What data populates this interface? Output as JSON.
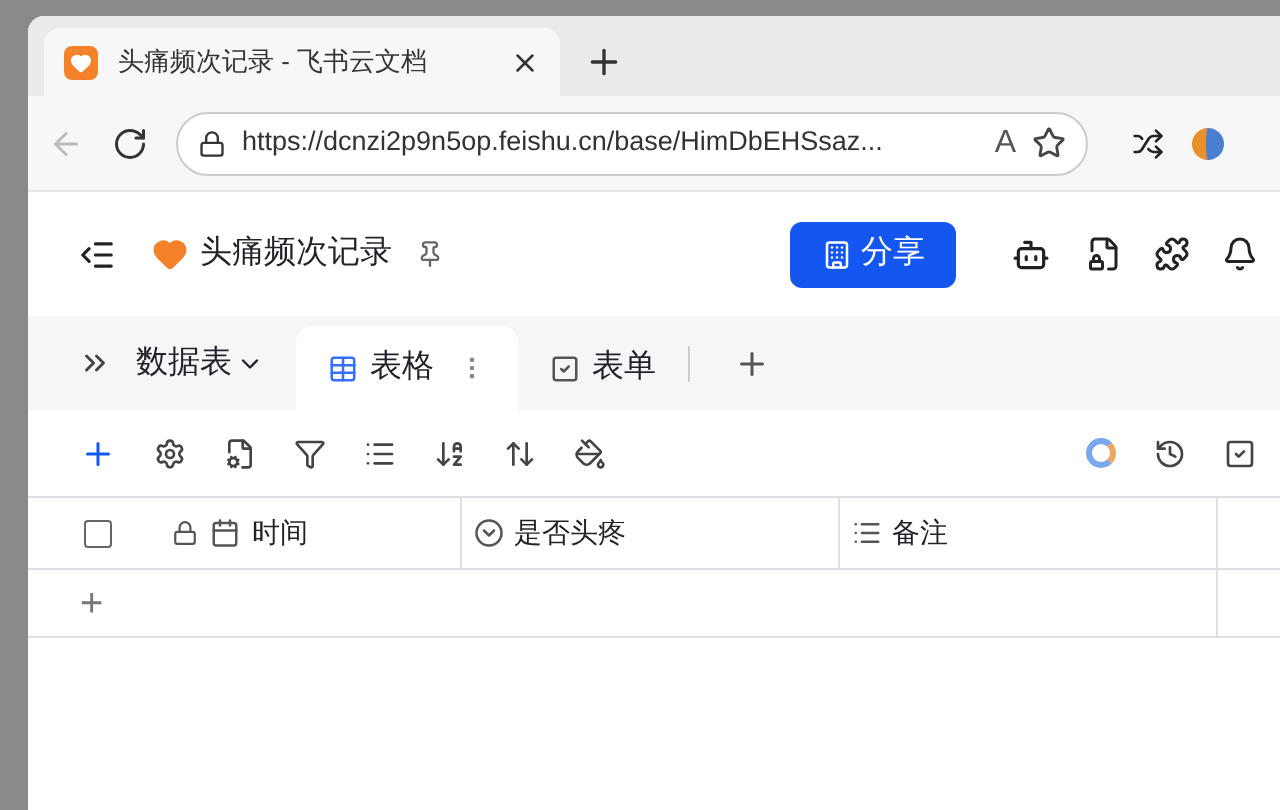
{
  "browser": {
    "tab_title": "头痛频次记录 - 飞书云文档",
    "url": "https://dcnzi2p9n5op.feishu.cn/base/HimDbEHSsaz...",
    "read_aloud": "A"
  },
  "doc": {
    "title": "头痛频次记录",
    "share_button": "分享"
  },
  "views_menu": "数据表",
  "tabs": [
    {
      "label": "表格",
      "kind": "grid",
      "selected": true
    },
    {
      "label": "表单",
      "kind": "form",
      "selected": false
    }
  ],
  "table": {
    "select_all": {
      "checked": false
    },
    "columns": [
      {
        "label": "时间",
        "kind": "date"
      },
      {
        "label": "是否头疼",
        "kind": "select"
      },
      {
        "label": "备注",
        "kind": "text"
      }
    ],
    "add_row": "+"
  }
}
